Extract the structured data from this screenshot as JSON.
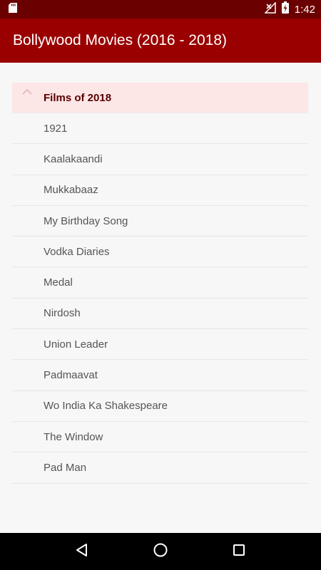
{
  "status_bar": {
    "time": "1:42",
    "icons": [
      "sd-card-icon",
      "signal-off-icon",
      "battery-charging-icon"
    ]
  },
  "app_bar": {
    "title": "Bollywood Movies (2016 - 2018)"
  },
  "group": {
    "label": "Films of 2018",
    "expanded": true,
    "items": [
      "1921",
      "Kaalakaandi",
      "Mukkabaaz",
      "My Birthday Song",
      "Vodka Diaries",
      "Medal",
      "Nirdosh",
      "Union Leader",
      "Padmaavat",
      "Wo India Ka Shakespeare",
      "The Window",
      "Pad Man"
    ]
  },
  "nav_bar": {
    "buttons": [
      "back-icon",
      "home-icon",
      "recents-icon"
    ]
  },
  "colors": {
    "status_bar": "#6b0000",
    "app_bar": "#9a0000",
    "group_header_bg": "#fde6e6",
    "group_header_text": "#5a0000"
  }
}
